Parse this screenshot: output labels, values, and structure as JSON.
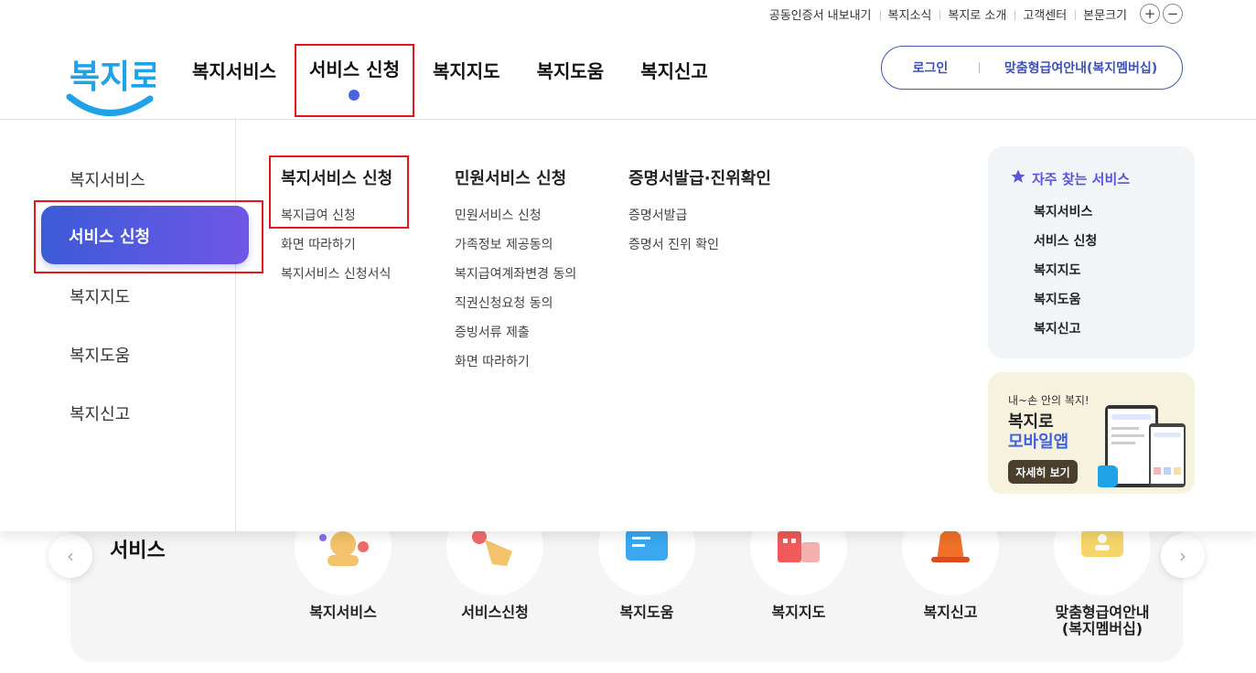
{
  "utility": {
    "links": [
      "공동인증서 내보내기",
      "복지소식",
      "복지로 소개",
      "고객센터"
    ],
    "font_size_label": "본문크기",
    "zoom_in": "+",
    "zoom_out": "−"
  },
  "logo": {
    "text": "복지로"
  },
  "gnb": {
    "items": [
      "복지서비스",
      "서비스 신청",
      "복지지도",
      "복지도움",
      "복지신고"
    ],
    "active_index": 1
  },
  "account": {
    "login": "로그인",
    "membership": "맞춤형급여안내(복지멤버십)"
  },
  "mega": {
    "side": [
      "복지서비스",
      "서비스 신청",
      "복지지도",
      "복지도움",
      "복지신고"
    ],
    "columns": [
      {
        "title": "복지서비스 신청",
        "links": [
          "복지급여 신청",
          "화면 따라하기",
          "복지서비스 신청서식"
        ]
      },
      {
        "title": "민원서비스 신청",
        "links": [
          "민원서비스 신청",
          "가족정보 제공동의",
          "복지급여계좌변경 동의",
          "직권신청요청 동의",
          "증빙서류 제출",
          "화면 따라하기"
        ]
      },
      {
        "title": "증명서발급·진위확인",
        "links": [
          "증명서발급",
          "증명서 진위 확인"
        ]
      }
    ],
    "favorites": {
      "title": "자주 찾는 서비스",
      "items": [
        "복지서비스",
        "서비스 신청",
        "복지지도",
        "복지도움",
        "복지신고"
      ]
    },
    "app_banner": {
      "subtitle": "내~손 안의 복지!",
      "title1": "복지로",
      "title2": "모바일앱",
      "button": "자세히 보기"
    }
  },
  "background": {
    "section_title": "서비스",
    "services": [
      "복지서비스",
      "서비스신청",
      "복지도움",
      "복지지도",
      "복지신고",
      "맞춤형급여안내\n(복지멤버십)"
    ],
    "prev": "‹",
    "next": "›"
  },
  "colors": {
    "brand_blue": "#3f62e0",
    "accent_purple": "#6f57e6",
    "highlight_red": "#e5161b",
    "logo_cyan": "#1fa3e8"
  }
}
